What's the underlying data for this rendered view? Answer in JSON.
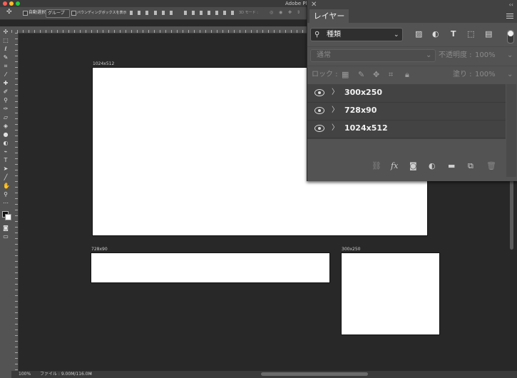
{
  "window": {
    "title": "Adobe Pho",
    "traffic_colors": [
      "#ff5f57",
      "#febc2e",
      "#28c840"
    ]
  },
  "options_bar": {
    "auto_select_label": "自動選択 :",
    "auto_select_value": "グループ",
    "bounding_box_label": "バウンディングボックスを表示",
    "mode_3d_label": "3D モード :"
  },
  "canvas": {
    "artboards": [
      {
        "label": "1024x512"
      },
      {
        "label": "728x90"
      },
      {
        "label": "300x250"
      }
    ]
  },
  "status": {
    "zoom": "100%",
    "file_info": "ファイル : 9.00M/116.0M"
  },
  "layers_panel": {
    "tab_title": "レイヤー",
    "filter_value": "種類",
    "blend_mode": "通常",
    "opacity_label": "不透明度 :",
    "opacity_value": "100%",
    "lock_label": "ロック :",
    "fill_label": "塗り :",
    "fill_value": "100%",
    "layers": [
      {
        "name": "300x250",
        "visible": true
      },
      {
        "name": "728x90",
        "visible": true
      },
      {
        "name": "1024x512",
        "visible": true
      }
    ],
    "footer_icons": [
      "link-icon",
      "fx-icon",
      "mask-icon",
      "adjustment-icon",
      "folder-icon",
      "new-layer-icon",
      "trash-icon"
    ]
  }
}
